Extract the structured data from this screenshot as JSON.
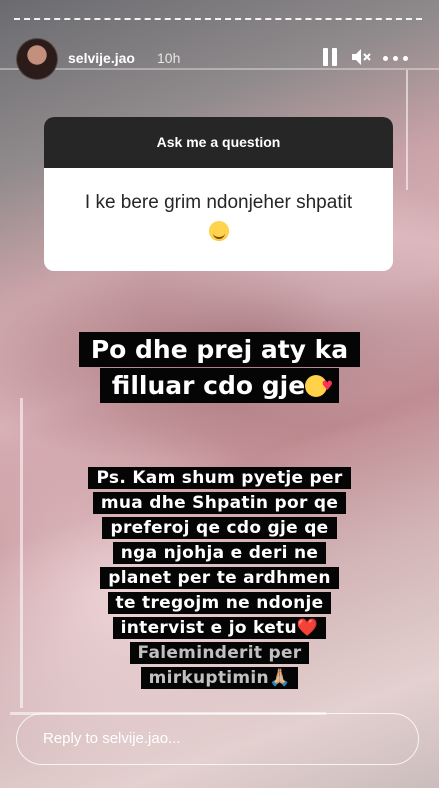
{
  "header": {
    "username": "selvije.jao",
    "time_ago": "10h",
    "icons": [
      "pause-icon",
      "mute-icon",
      "more-icon"
    ]
  },
  "question": {
    "title": "Ask me a question",
    "text": "I ke bere grim ndonjeher shpatit",
    "emoji": "☺️"
  },
  "caption1": {
    "line1": "Po dhe prej aty ka",
    "line2": "filluar cdo gje",
    "emoji": "🥰"
  },
  "caption2": {
    "lines": [
      "Ps. Kam shum pyetje per",
      "mua dhe Shpatin por qe",
      "preferoj qe cdo gje qe",
      "nga njohja e deri ne",
      "planet per te ardhmen",
      "te tregojm ne ndonje",
      "intervist e jo ketu"
    ],
    "heart": "❤️",
    "line8": "Faleminderit per",
    "line9": "mirkuptimin",
    "hands": "🙏🏼"
  },
  "reply": {
    "placeholder": "Reply to selvije.jao..."
  },
  "colors": {
    "card_header": "#262626",
    "marker": "#050505",
    "heart": "#e8132e"
  }
}
